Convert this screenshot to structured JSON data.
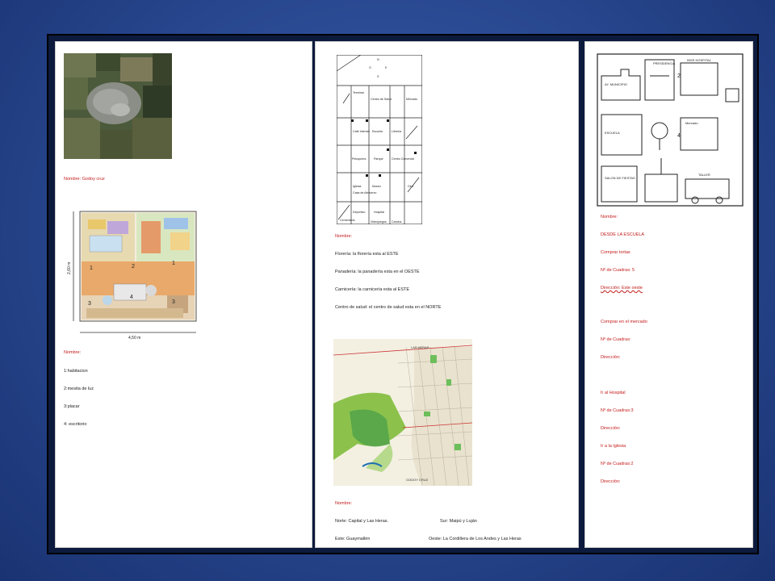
{
  "page1": {
    "aerial_caption": "Nombre: Godoy cruz",
    "floorplan": {
      "height_label": "2,60 m",
      "width_label": "4,50 m",
      "zones": [
        "1",
        "2",
        "1",
        "3",
        "4",
        "3"
      ]
    },
    "list_title": "Nombre:",
    "items": [
      "1:habitacion",
      "2:mesita de luz",
      "3:placar",
      "4: escritorio"
    ]
  },
  "page2": {
    "street_map": {
      "compass": {
        "n": "N",
        "s": "S",
        "e": "E",
        "o": "O"
      },
      "blocks": [
        "Terminal",
        "Centro de Salud",
        "Mercado",
        "Café Internet",
        "Escuela",
        "Librería",
        "Peluquería",
        "Parque",
        "Centro Comercial",
        "Iglesia",
        "Casa de Almuerzo",
        "Museo",
        "Cine",
        "Deportivo",
        "Hospital",
        "Cementerio",
        "Videojuegos",
        "Cancha"
      ]
    },
    "section_title": "Nombre:",
    "lines": [
      "Florería: la florería esta al ESTE",
      "Panadería: la panadería esta en el OESTE",
      "Carnicería: la carnicería esta al ESTE",
      "Centro de salud: el centro de salud esta en el NORTE"
    ],
    "city_map": {
      "label_top": "LAS HERAS",
      "label_bottom": "GODOY CRUZ"
    },
    "bottom_title": "Nombre:",
    "limits": {
      "norte": "Norte:   Capital y Las Heras.",
      "sur": "Sur: Maipú y Luján",
      "este": "Este:  Guaymallén",
      "oeste": "Oeste: La Cordillera de Los Andes y Las Heras"
    }
  },
  "page3": {
    "drawing_labels": {
      "presidencia": "PRESIDENCIA",
      "hospital": "INSS HOSPITAL",
      "ayuntamiento": "AY. MUNICIPIO",
      "escuela": "ESCUELA",
      "mercado": "Mercado",
      "salon": "SALON DE FIESTAS",
      "taller": "TALLER",
      "num_2": "2",
      "num_4": "4"
    },
    "name_label": "Nombre:",
    "desde": "DESDE  LA ESCUELA",
    "comprar": "Comprar tortas",
    "cuadras_5": "Nº de Cuadras:  5",
    "direccion_italic": "Dirección: Este oeste",
    "comprar_mercado": "Comprar en el mercado",
    "cuadras_mercado": "Nº de Cuadras:",
    "direccion1": "Dirección:",
    "hospital": "Ir al Hospital",
    "cuadras_hosp": "Nº de Cuadras:3",
    "direccion2": "Dirección:",
    "iglesia": "Ir a la Iglesia",
    "cuadras_igl": "Nº de Cuadras:2",
    "direccion3": "Dirección:"
  },
  "colors": {
    "background": "#2a4a93",
    "frame": "#0c1a3d",
    "page": "#ffffff",
    "red_text": "#c31a1a"
  }
}
